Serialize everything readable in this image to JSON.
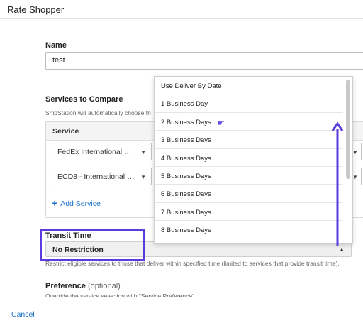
{
  "header": {
    "title": "Rate Shopper"
  },
  "name_section": {
    "label": "Name",
    "value": "test"
  },
  "services": {
    "heading": "Services to Compare",
    "helper": "ShipStation will automatically choose th",
    "column_header": "Service",
    "rows": [
      {
        "service": "FedEx International Pri..."
      },
      {
        "service": "ECD8 - International Ex..."
      }
    ],
    "add_label": "Add Service"
  },
  "transit": {
    "label": "Transit Time",
    "selected": "No Restriction",
    "helper": "Restrict eligible services to those that deliver within specified time (limited to services that provide transit time)."
  },
  "preference": {
    "label": "Preference",
    "optional": "(optional)",
    "helper": "Override the service selection with \"Service Preference\""
  },
  "footer": {
    "cancel_label": "Cancel"
  },
  "dropdown": {
    "options": [
      "Use Deliver By Date",
      "1 Business Day",
      "2 Business Days",
      "3 Business Days",
      "4 Business Days",
      "5 Business Days",
      "6 Business Days",
      "7 Business Days",
      "8 Business Days"
    ]
  },
  "colors": {
    "annotation": "#5b3bdc",
    "link": "#1a73c8"
  }
}
